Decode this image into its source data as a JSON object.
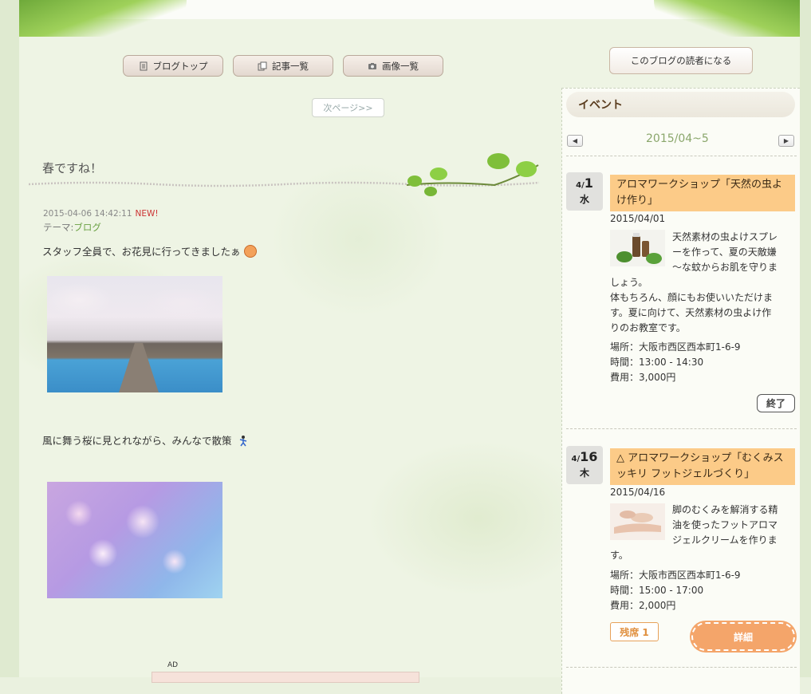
{
  "nav": {
    "blog_top": "ブログトップ",
    "article_list": "記事一覧",
    "image_list": "画像一覧",
    "next_page": "次ページ>>"
  },
  "post": {
    "title": "春ですね！",
    "datetime": "2015-04-06 14:42:11",
    "new_badge": "NEW!",
    "theme_label": "テーマ:",
    "theme_link": "ブログ",
    "paragraph1": "スタッフ全員で、お花見に行ってきましたぁ",
    "paragraph2": "風に舞う桜に見とれながら、みんなで散策",
    "ad_label": "AD"
  },
  "sidebar": {
    "reader_button": "このブログの読者になる",
    "event_header": "イベント",
    "calendar_month": "2015/04~5",
    "prev_arrow": "◀",
    "next_arrow": "▶",
    "events": [
      {
        "month_prefix": "4/",
        "day": "1",
        "weekday": "水",
        "title": "アロマワークショップ「天然の虫よけ作り」",
        "date": "2015/04/01",
        "desc_lines": [
          "天然素材の虫よけスプレ",
          "ーを作って、夏の天敵嫌",
          "～な蚊からお肌を守りま"
        ],
        "desc_full": [
          "しょう。",
          "体もちろん、顔にもお使いいただけま",
          "す。夏に向けて、天然素材の虫よけ作",
          "りのお教室です。"
        ],
        "place": "場所：大阪市西区西本町1-6-9",
        "time": "時間：13:00 - 14:30",
        "fee": "費用：3,000円",
        "status_button": "終了"
      },
      {
        "month_prefix": "4/",
        "day": "16",
        "weekday": "木",
        "title": "△ アロマワークショップ「むくみスッキリ フットジェルづくり」",
        "date": "2015/04/16",
        "desc_lines": [
          "脚のむくみを解消する精",
          "油を使ったフットアロマ",
          "ジェルクリームを作りま"
        ],
        "desc_full": [
          "す。"
        ],
        "place": "場所：大阪市西区西本町1-6-9",
        "time": "時間：15:00 - 17:00",
        "fee": "費用：2,000円",
        "seat_badge": "残席 1",
        "detail_button": "詳細"
      }
    ]
  },
  "colors": {
    "accent_orange": "#fccb88",
    "detail_button": "#f4a56a",
    "new_red": "#cc3333",
    "link_green": "#6aa043"
  }
}
